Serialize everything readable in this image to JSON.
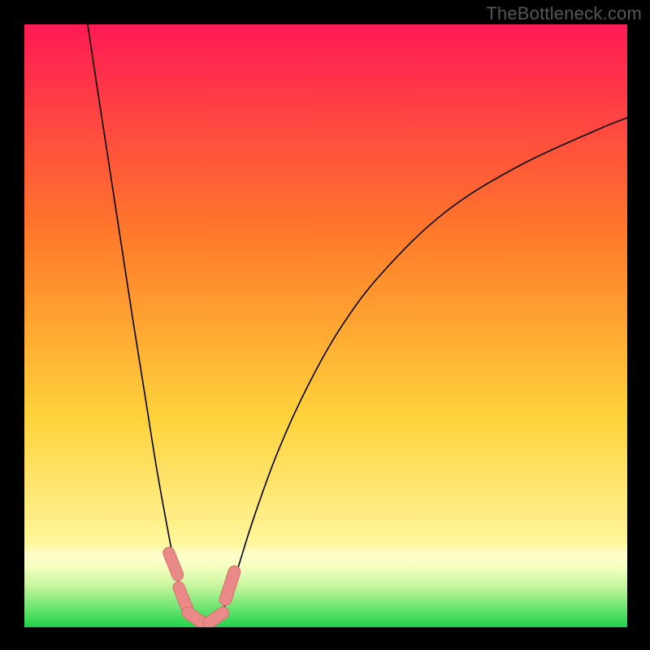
{
  "watermark": "TheBottleneck.com",
  "colors": {
    "frame": "#000000",
    "gradient_top": "#ff1a55",
    "gradient_mid1": "#ff7a2a",
    "gradient_mid2": "#ffd23a",
    "gradient_mid3": "#fff59a",
    "gradient_green": "#1fd34a",
    "curve": "#000000",
    "marker_fill": "#e98a88",
    "marker_stroke": "#d86c6a"
  },
  "chart_data": {
    "type": "line",
    "title": "",
    "xlabel": "",
    "ylabel": "",
    "xlim": [
      0,
      100
    ],
    "ylim": [
      0,
      100
    ],
    "grid": false,
    "legend": false,
    "series": [
      {
        "name": "curve_left",
        "x": [
          10.5,
          12,
          14,
          16,
          18,
          20,
          22,
          24,
          25.5,
          27,
          28.3
        ],
        "values": [
          100,
          90,
          77,
          64,
          51,
          38.5,
          26,
          15,
          7.5,
          3,
          1
        ]
      },
      {
        "name": "curve_right",
        "x": [
          31.7,
          33,
          35,
          38,
          42,
          47,
          53,
          60,
          70,
          82,
          95,
          100
        ],
        "values": [
          1,
          3,
          8.5,
          18,
          29,
          40,
          50.5,
          59.5,
          69,
          76.5,
          82.5,
          84.5
        ]
      }
    ],
    "flat_bottom": {
      "x1": 28.3,
      "x2": 31.7,
      "y": 1
    },
    "markers": [
      {
        "x": 24.7,
        "y": 10.5,
        "w": 1.9,
        "h": 5.8,
        "angle": -22
      },
      {
        "x": 26.3,
        "y": 4.9,
        "w": 1.9,
        "h": 5.6,
        "angle": -22
      },
      {
        "x": 28.3,
        "y": 1.6,
        "w": 2.0,
        "h": 4.8,
        "angle": -55
      },
      {
        "x": 31.8,
        "y": 1.6,
        "w": 2.0,
        "h": 4.8,
        "angle": 55
      },
      {
        "x": 34.1,
        "y": 6.9,
        "w": 2.0,
        "h": 6.8,
        "angle": 18
      }
    ]
  }
}
